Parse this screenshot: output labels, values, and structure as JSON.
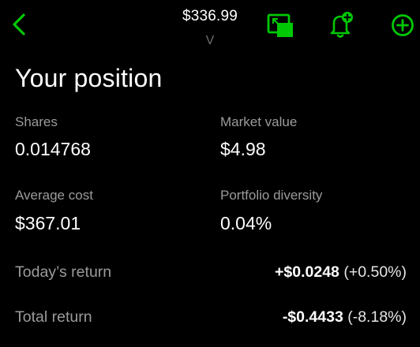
{
  "header": {
    "price": "$336.99",
    "ticker": "V",
    "back_icon": "chevron-left-icon",
    "pip_icon": "picture-in-picture-icon",
    "alert_icon": "bell-plus-icon",
    "add_icon": "plus-circle-icon"
  },
  "colors": {
    "accent": "#00c805",
    "background": "#000000",
    "label": "#9b9b9b",
    "value": "#ffffff"
  },
  "position": {
    "title": "Your position",
    "shares_label": "Shares",
    "shares_value": "0.014768",
    "market_value_label": "Market value",
    "market_value": "$4.98",
    "average_cost_label": "Average cost",
    "average_cost_value": "$367.01",
    "portfolio_diversity_label": "Portfolio diversity",
    "portfolio_diversity_value": "0.04%",
    "todays_return_label": "Today’s return",
    "todays_return_amount": "+$0.0248",
    "todays_return_percent": "(+0.50%)",
    "total_return_label": "Total return",
    "total_return_amount": "-$0.4433",
    "total_return_percent": "(-8.18%)"
  }
}
